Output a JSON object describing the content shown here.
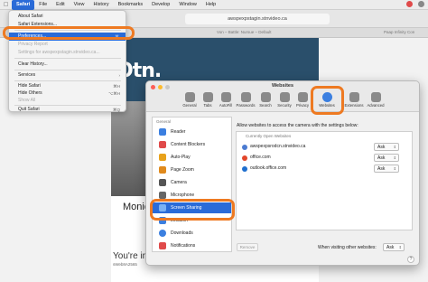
{
  "menubar": {
    "apple_icon": "apple-logo-icon",
    "items": [
      "Safari",
      "File",
      "Edit",
      "View",
      "History",
      "Bookmarks",
      "Develop",
      "Window",
      "Help"
    ],
    "active": "Safari"
  },
  "browser": {
    "url": "awspexpstagin.stnvideo.ca",
    "tabs": [
      "Von – Battle: Nursue – Default",
      "Paap Infinity Con"
    ]
  },
  "webpage": {
    "brand": "Otn.",
    "speaker_name": "Monic",
    "youre": "You're in",
    "youre_sub": "sWeb8A2565"
  },
  "safari_menu": {
    "items": [
      {
        "label": "About Safari",
        "shortcut": "",
        "state": "normal"
      },
      {
        "label": "Safari Extensions...",
        "shortcut": "",
        "state": "normal"
      },
      {
        "label": "Preferences...",
        "shortcut": "⌘,",
        "state": "selected"
      },
      {
        "label": "Privacy Report",
        "shortcut": "",
        "state": "dim"
      },
      {
        "label": "Settings for awspexpstagin.stnvideo.ca...",
        "shortcut": "",
        "state": "dim"
      },
      {
        "label": "Clear History...",
        "shortcut": "",
        "state": "normal"
      },
      {
        "label": "Services",
        "shortcut": "›",
        "state": "normal"
      },
      {
        "label": "Hide Safari",
        "shortcut": "⌘H",
        "state": "normal"
      },
      {
        "label": "Hide Others",
        "shortcut": "⌥⌘H",
        "state": "normal"
      },
      {
        "label": "Show All",
        "shortcut": "",
        "state": "dim"
      },
      {
        "label": "Quit Safari",
        "shortcut": "⌘Q",
        "state": "normal"
      }
    ]
  },
  "prefs": {
    "title": "Websites",
    "tabs": [
      "General",
      "Tabs",
      "AutoFill",
      "Passwords",
      "Search",
      "Security",
      "Privacy",
      "Websites",
      "Extensions",
      "Advanced"
    ],
    "active_tab": "Websites",
    "sidebar_header": "General",
    "sidebar_items": [
      "Reader",
      "Content Blockers",
      "Auto-Play",
      "Page Zoom",
      "Camera",
      "Microphone",
      "Screen Sharing",
      "Location",
      "Downloads",
      "Notifications"
    ],
    "sidebar_selected": "Screen Sharing",
    "description": "Allow websites to access the camera with the settings below:",
    "panel_header": "Currently Open Websites",
    "sites": [
      {
        "name": "awspexpsrodcn.stnvideo.ca",
        "value": "Ask",
        "color": "#4b7bd1"
      },
      {
        "name": "office.com",
        "value": "Ask",
        "color": "#e2462b"
      },
      {
        "name": "outlook.office.com",
        "value": "Ask",
        "color": "#1f6fce"
      }
    ],
    "remove_label": "Remove",
    "other_label": "When visiting other websites:",
    "other_value": "Ask",
    "help_label": "?"
  },
  "colors": {
    "highlight": "#ee7a22",
    "selection": "#2a6bd8"
  }
}
